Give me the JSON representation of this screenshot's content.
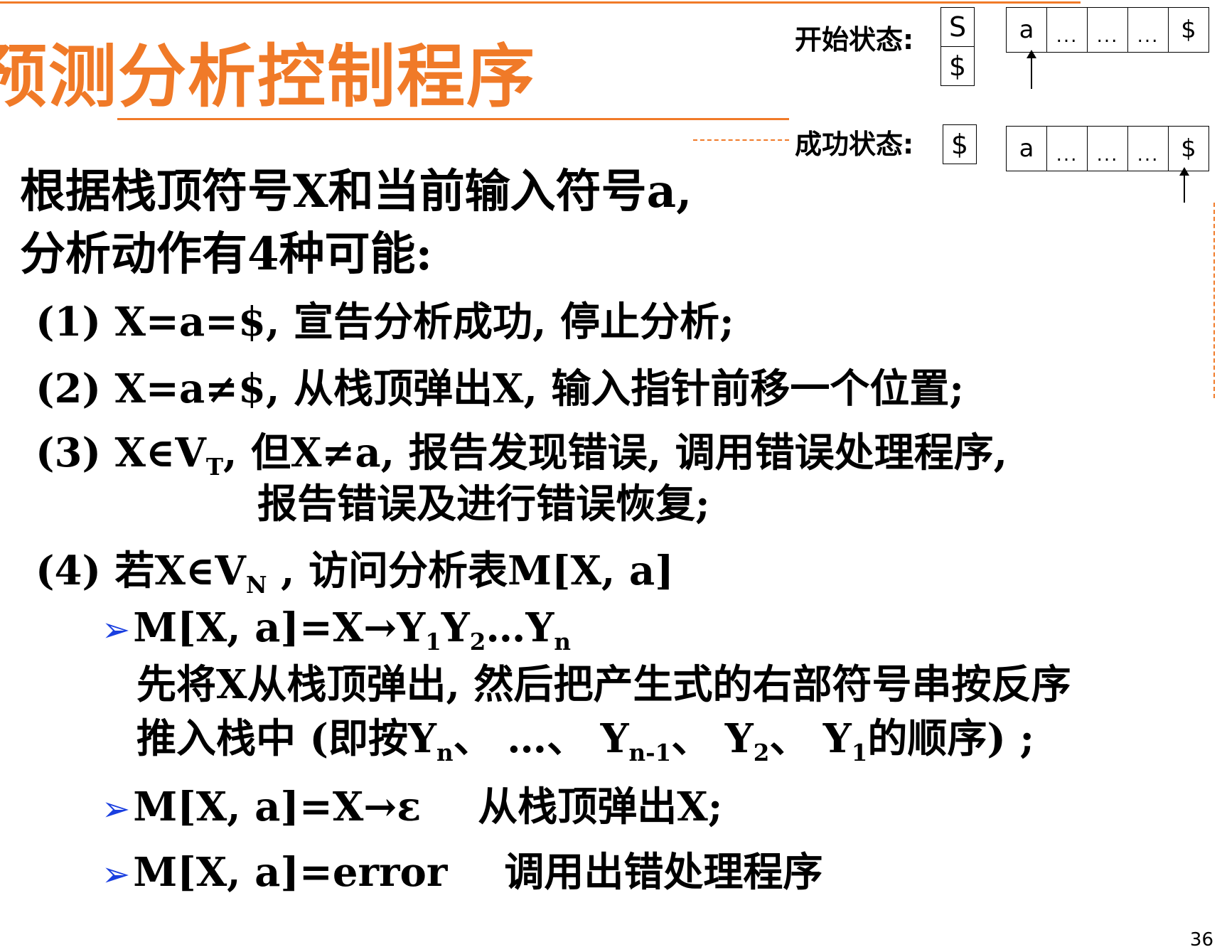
{
  "slide": {
    "title": "预测分析控制程序",
    "page_number": "36"
  },
  "diagram": {
    "start_label": "开始状态:",
    "success_label": "成功状态:",
    "start_stack": [
      "S",
      "$"
    ],
    "success_stack": [
      "$"
    ],
    "tape": [
      "a",
      "...",
      "...",
      "...",
      "$"
    ]
  },
  "content": {
    "intro_line1": "根据栈顶符号X和当前输入符号a,",
    "intro_line2": "分析动作有4种可能:",
    "case1": "(1) X=a=$, 宣告分析成功, 停止分析;",
    "case2": "(2) X=a≠$, 从栈顶弹出X, 输入指针前移一个位置;",
    "case3_a": "(3) X∈V",
    "case3_sub": "T",
    "case3_b": ", 但X≠a, 报告发现错误, 调用错误处理程序,",
    "case3_line2": "报告错误及进行错误恢复;",
    "case4_a": "(4) 若X∈V",
    "case4_sub": "N",
    "case4_b": " , 访问分析表M[X, a]",
    "b1_a": "M[X, a]=X→Y",
    "b1_sub1": "1",
    "b1_b": "Y",
    "b1_sub2": "2",
    "b1_c": "…Y",
    "b1_subn": "n",
    "b1_line2": "先将X从栈顶弹出, 然后把产生式的右部符号串按反序",
    "b1_l3_a": "推入栈中 (即按Y",
    "b1_l3_sub1": "n",
    "b1_l3_b": "、 …、 Y",
    "b1_l3_sub2": "n-1",
    "b1_l3_c": "、 Y",
    "b1_l3_sub3": "2",
    "b1_l3_d": "、 Y",
    "b1_l3_sub4": "1",
    "b1_l3_e": "的顺序) ;",
    "b2_a": "M[X, a]=X→ε",
    "b2_b": "从栈顶弹出X;",
    "b3_a": "M[X, a]=error",
    "b3_b": "调用出错处理程序",
    "bullet_glyph": "➢"
  }
}
